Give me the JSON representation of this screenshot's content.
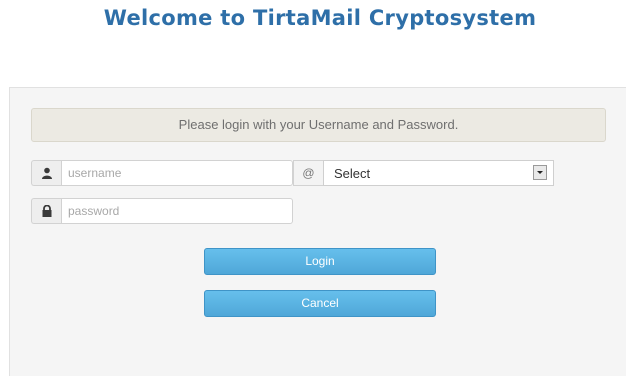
{
  "header": {
    "title": "Welcome to TirtaMail Cryptosystem"
  },
  "login": {
    "notice": "Please login with your Username and Password.",
    "username": {
      "icon": "user-icon",
      "placeholder": "username",
      "value": ""
    },
    "at_symbol": "@",
    "domain": {
      "selected": "Select"
    },
    "password": {
      "icon": "lock-icon",
      "placeholder": "password",
      "value": ""
    },
    "buttons": {
      "login_label": "Login",
      "cancel_label": "Cancel"
    }
  },
  "colors": {
    "title": "#2e6fa8",
    "button": "#5bb5e4",
    "panel_bg": "#f5f5f5",
    "notice_bg": "#eceae3"
  }
}
